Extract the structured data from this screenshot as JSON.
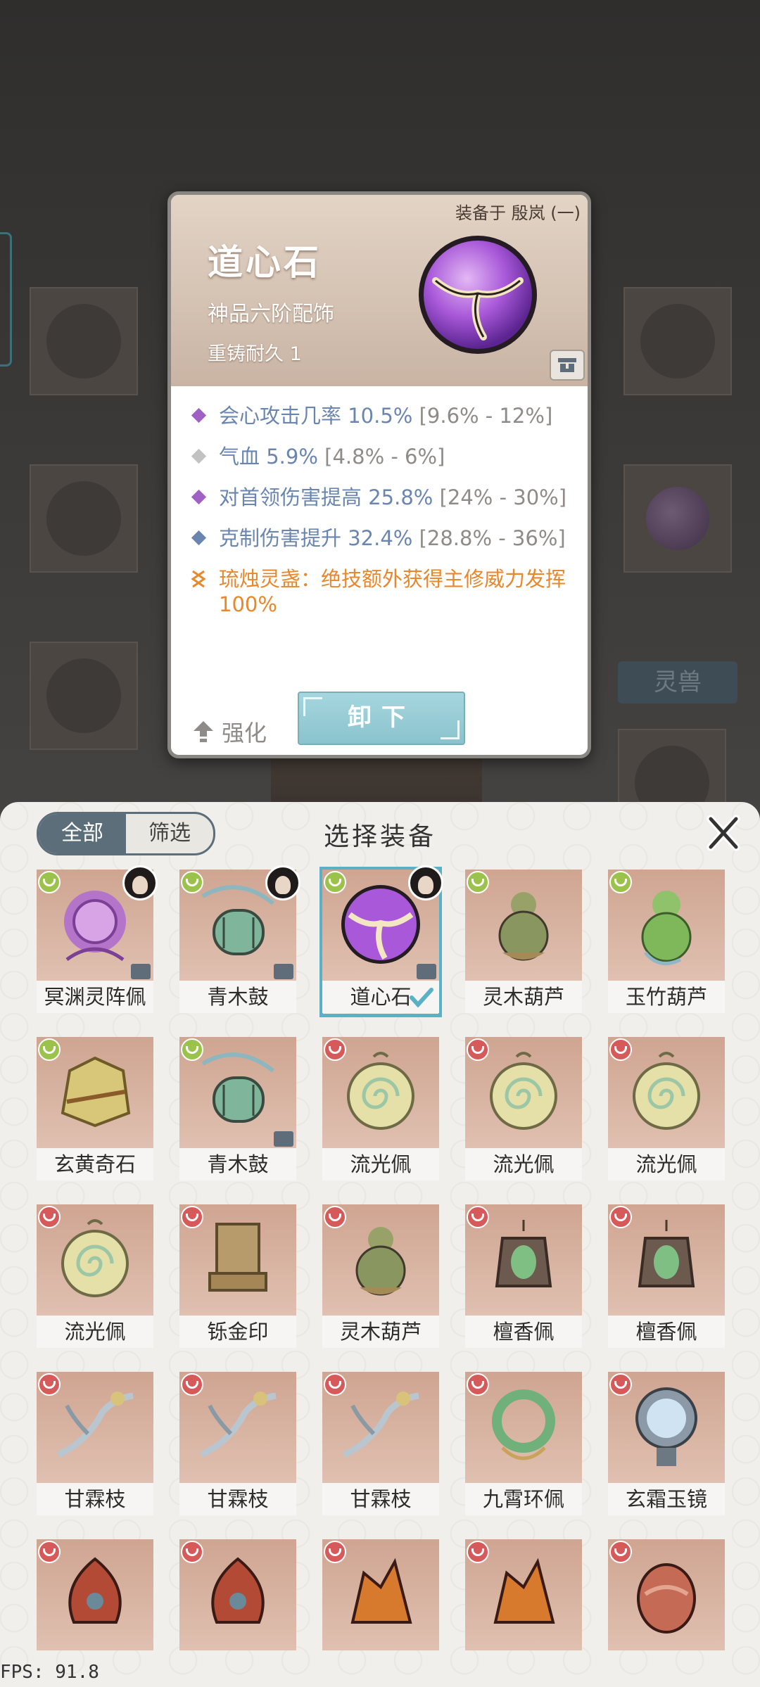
{
  "detail": {
    "equipped_by": "装备于 殷岚 (一)",
    "name": "道心石",
    "type": "神品六阶配饰",
    "recast": "重铸耐久 1",
    "stats": [
      {
        "gem_color": "#a061c4",
        "label": "会心攻击几率",
        "value": "10.5%",
        "range": "[9.6% - 12%]"
      },
      {
        "gem_color": "#c2c2c2",
        "label": "气血",
        "value": "5.9%",
        "range": "[4.8% - 6%]"
      },
      {
        "gem_color": "#a061c4",
        "label": "对首领伤害提高",
        "value": "25.8%",
        "range": "[24% - 30%]"
      },
      {
        "gem_color": "#6a86b0",
        "label": "克制伤害提升",
        "value": "32.4%",
        "range": "[28.8% - 36%]"
      }
    ],
    "special": "琉烛灵盏：绝技额外获得主修威力发挥100%",
    "strengthen_label": "强化",
    "unequip_label": "卸下"
  },
  "background": {
    "side_tab_label": "灵兽"
  },
  "panel": {
    "filter_all": "全部",
    "filter_screen": "筛选",
    "title": "选择装备",
    "items": [
      {
        "name": "冥渊灵阵佩",
        "art": "purple-orb-pendant-icon",
        "badge_color": "#9bc24a",
        "avatar": true,
        "lock": true
      },
      {
        "name": "青木鼓",
        "art": "drum-icon",
        "badge_color": "#9bc24a",
        "avatar": true,
        "lock": true
      },
      {
        "name": "道心石",
        "art": "dao-heart-stone-icon",
        "badge_color": "#9bc24a",
        "avatar": true,
        "lock": true,
        "selected": true
      },
      {
        "name": "灵木葫芦",
        "art": "gourd-icon",
        "badge_color": "#9bc24a"
      },
      {
        "name": "玉竹葫芦",
        "art": "jade-gourd-icon",
        "badge_color": "#9bc24a"
      },
      {
        "name": "玄黄奇石",
        "art": "yellow-stone-icon",
        "badge_color": "#9bc24a"
      },
      {
        "name": "青木鼓",
        "art": "drum-icon",
        "badge_color": "#9bc24a",
        "lock": true
      },
      {
        "name": "流光佩",
        "art": "spiral-pendant-icon",
        "badge_color": "#d65a5a"
      },
      {
        "name": "流光佩",
        "art": "spiral-pendant-icon",
        "badge_color": "#d65a5a"
      },
      {
        "name": "流光佩",
        "art": "spiral-pendant-icon",
        "badge_color": "#d65a5a"
      },
      {
        "name": "流光佩",
        "art": "spiral-pendant-icon",
        "badge_color": "#d65a5a"
      },
      {
        "name": "铄金印",
        "art": "golden-seal-icon",
        "badge_color": "#d65a5a"
      },
      {
        "name": "灵木葫芦",
        "art": "gourd-icon",
        "badge_color": "#d65a5a"
      },
      {
        "name": "檀香佩",
        "art": "incense-pendant-icon",
        "badge_color": "#d65a5a"
      },
      {
        "name": "檀香佩",
        "art": "incense-pendant-icon",
        "badge_color": "#d65a5a"
      },
      {
        "name": "甘霖枝",
        "art": "branch-icon",
        "badge_color": "#d65a5a"
      },
      {
        "name": "甘霖枝",
        "art": "branch-icon",
        "badge_color": "#d65a5a"
      },
      {
        "name": "甘霖枝",
        "art": "branch-icon",
        "badge_color": "#d65a5a"
      },
      {
        "name": "九霄环佩",
        "art": "jade-ring-icon",
        "badge_color": "#d65a5a"
      },
      {
        "name": "玄霜玉镜",
        "art": "mirror-icon",
        "badge_color": "#d65a5a"
      },
      {
        "name": "",
        "art": "red-gem-icon",
        "badge_color": "#d65a5a"
      },
      {
        "name": "",
        "art": "red-gem-icon",
        "badge_color": "#d65a5a"
      },
      {
        "name": "",
        "art": "flame-crystal-icon",
        "badge_color": "#d65a5a"
      },
      {
        "name": "",
        "art": "flame-crystal-icon",
        "badge_color": "#d65a5a"
      },
      {
        "name": "",
        "art": "red-knot-icon",
        "badge_color": "#d65a5a"
      }
    ]
  },
  "fps": "FPS: 91.8"
}
